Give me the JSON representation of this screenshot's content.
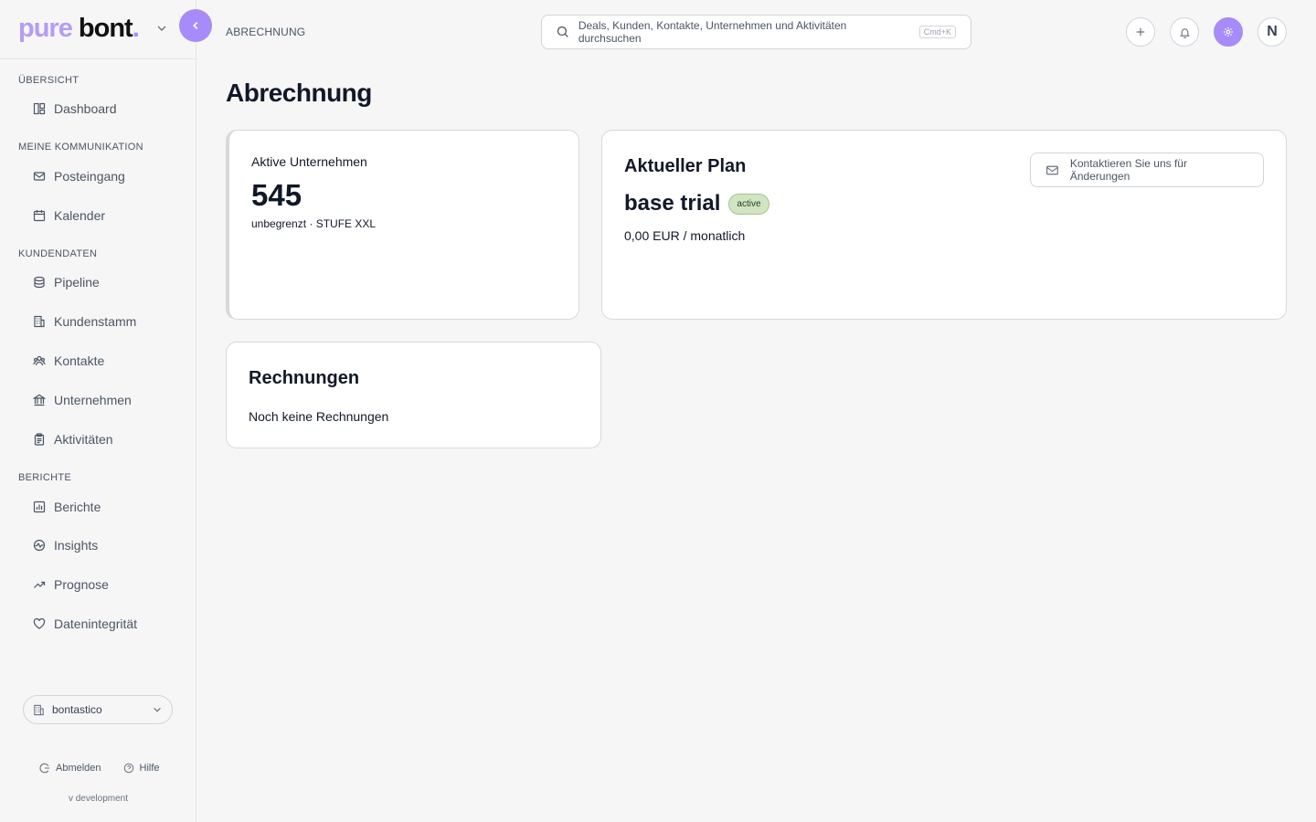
{
  "brand": {
    "logo_part1": "pure",
    "logo_part2": "bont",
    "logo_dot": "."
  },
  "header": {
    "breadcrumb": "ABRECHNUNG",
    "search_placeholder": "Deals, Kunden, Kontakte, Unternehmen und Aktivitäten durchsuchen",
    "search_shortcut": "Cmd+K",
    "avatar_initial": "N"
  },
  "sidebar": {
    "sections": [
      {
        "title": "ÜBERSICHT",
        "items": [
          {
            "label": "Dashboard",
            "icon": "dashboard-icon"
          }
        ]
      },
      {
        "title": "MEINE KOMMUNIKATION",
        "items": [
          {
            "label": "Posteingang",
            "icon": "mail-icon"
          },
          {
            "label": "Kalender",
            "icon": "calendar-icon"
          }
        ]
      },
      {
        "title": "KUNDENDATEN",
        "items": [
          {
            "label": "Pipeline",
            "icon": "database-icon"
          },
          {
            "label": "Kundenstamm",
            "icon": "building-icon"
          },
          {
            "label": "Kontakte",
            "icon": "users-icon"
          },
          {
            "label": "Unternehmen",
            "icon": "bank-icon"
          },
          {
            "label": "Aktivitäten",
            "icon": "clipboard-icon"
          }
        ]
      },
      {
        "title": "BERICHTE",
        "items": [
          {
            "label": "Berichte",
            "icon": "bar-chart-icon"
          },
          {
            "label": "Insights",
            "icon": "activity-icon"
          },
          {
            "label": "Prognose",
            "icon": "trending-up-icon"
          },
          {
            "label": "Datenintegrität",
            "icon": "heart-icon"
          }
        ]
      }
    ],
    "org_select": "bontastico",
    "logout_label": "Abmelden",
    "help_label": "Hilfe",
    "version": "v development"
  },
  "main": {
    "title": "Abrechnung",
    "companies_card": {
      "label": "Aktive Unternehmen",
      "count": "545",
      "detail": "unbegrenzt · STUFE XXL"
    },
    "plan_card": {
      "heading": "Aktueller Plan",
      "plan_name": "base trial",
      "status_badge": "active",
      "price": "0,00 EUR / monatlich",
      "contact_button": "Kontaktieren Sie uns für Änderungen"
    },
    "invoices_card": {
      "heading": "Rechnungen",
      "empty_text": "Noch keine Rechnungen"
    }
  },
  "colors": {
    "accent": "#a78bfa",
    "badge_bg": "#d1e5c3",
    "background": "#f6f6f6"
  }
}
